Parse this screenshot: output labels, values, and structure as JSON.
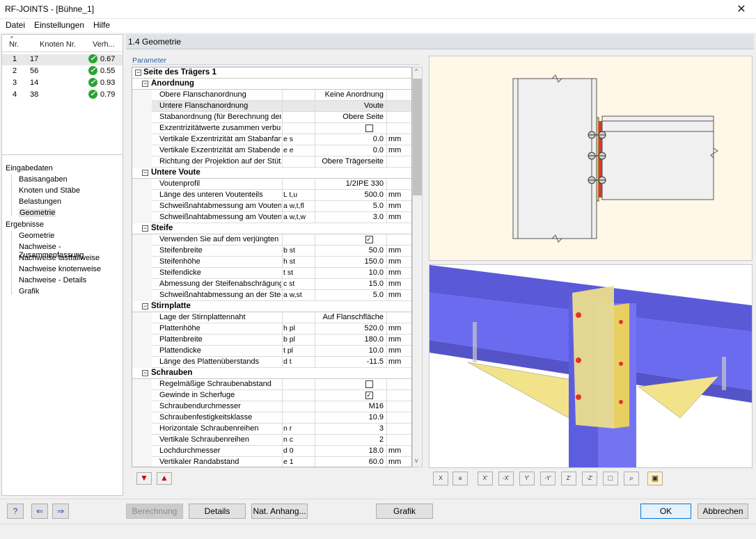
{
  "window": {
    "title": "RF-JOINTS - [Bühne_1]",
    "close_glyph": "✕"
  },
  "menu": [
    "Datei",
    "Einstellungen",
    "Hilfe"
  ],
  "nodes": {
    "headers": [
      "Nr.",
      "Knoten Nr.",
      "Verh..."
    ],
    "rows": [
      {
        "nr": "1",
        "knoten": "17",
        "verh": "0.67"
      },
      {
        "nr": "2",
        "knoten": "56",
        "verh": "0.55"
      },
      {
        "nr": "3",
        "knoten": "14",
        "verh": "0.93"
      },
      {
        "nr": "4",
        "knoten": "38",
        "verh": "0.79"
      }
    ]
  },
  "tree": {
    "eingabe": "Eingabedaten",
    "eingabe_items": [
      "Basisangaben",
      "Knoten und Stäbe",
      "Belastungen",
      "Geometrie"
    ],
    "ergebnisse": "Ergebnisse",
    "ergebnisse_items": [
      "Geometrie",
      "Nachweise - Zusammenfassung",
      "Nachweise lastfallweise",
      "Nachweise knotenweise",
      "Nachweise - Details",
      "Grafik"
    ]
  },
  "panel": {
    "title": "1.4 Geometrie",
    "param_label": "Parameter"
  },
  "grid": {
    "top_section": "Seite des Trägers 1",
    "rows": [
      {
        "type": "sec",
        "label": "Anordnung"
      },
      {
        "name": "Obere Flanschanordnung",
        "sym": "",
        "val": "Keine Anordnung",
        "unit": ""
      },
      {
        "name": "Untere Flanschanordnung",
        "sym": "",
        "val": "Voute",
        "unit": "",
        "sel": true
      },
      {
        "name": "Stabanordnung (für Berechnung der",
        "sym": "",
        "val": "Obere Seite",
        "unit": ""
      },
      {
        "name": "Exzentrizitätwerte zusammen verbun",
        "sym": "",
        "val": "",
        "unit": "",
        "cb": "unchecked"
      },
      {
        "name": "Vertikale Exzentrizität am Stabanfang",
        "sym": "e s",
        "val": "0.0",
        "unit": "mm"
      },
      {
        "name": "Vertikale Exzentrizität am Stabende",
        "sym": "e e",
        "val": "0.0",
        "unit": "mm"
      },
      {
        "name": "Richtung der Projektion auf der Stütz",
        "sym": "",
        "val": "Obere Trägerseite",
        "unit": ""
      },
      {
        "type": "sec",
        "label": "Untere Voute"
      },
      {
        "name": "Voutenprofil",
        "sym": "",
        "val": "1/2IPE 330",
        "unit": ""
      },
      {
        "name": "Länge des unteren Voutenteils",
        "sym": "L t,u",
        "val": "500.0",
        "unit": "mm"
      },
      {
        "name": "Schweißnahtabmessung am Voutenf",
        "sym": "a w,t,fl",
        "val": "5.0",
        "unit": "mm"
      },
      {
        "name": "Schweißnahtabmessung am Voutens",
        "sym": "a w,t,w",
        "val": "3.0",
        "unit": "mm"
      },
      {
        "type": "sec",
        "label": "Steife"
      },
      {
        "name": "Verwenden Sie auf dem verjüngten I",
        "sym": "",
        "val": "",
        "unit": "",
        "cb": "checked"
      },
      {
        "name": "Steifenbreite",
        "sym": "b st",
        "val": "50.0",
        "unit": "mm"
      },
      {
        "name": "Steifenhöhe",
        "sym": "h st",
        "val": "150.0",
        "unit": "mm"
      },
      {
        "name": "Steifendicke",
        "sym": "t st",
        "val": "10.0",
        "unit": "mm"
      },
      {
        "name": "Abmessung der Steifenabschrägung",
        "sym": "c st",
        "val": "15.0",
        "unit": "mm"
      },
      {
        "name": "Schweißnahtabmessung an der Steg",
        "sym": "a w,st",
        "val": "5.0",
        "unit": "mm"
      },
      {
        "type": "sec",
        "label": "Stirnplatte"
      },
      {
        "name": "Lage der Stirnplattennaht",
        "sym": "",
        "val": "Auf Flanschfläche",
        "unit": ""
      },
      {
        "name": "Plattenhöhe",
        "sym": "h pl",
        "val": "520.0",
        "unit": "mm"
      },
      {
        "name": "Plattenbreite",
        "sym": "b pl",
        "val": "180.0",
        "unit": "mm"
      },
      {
        "name": "Plattendicke",
        "sym": "t pl",
        "val": "10.0",
        "unit": "mm"
      },
      {
        "name": "Länge des Plattenüberstands",
        "sym": "d t",
        "val": "-11.5",
        "unit": "mm"
      },
      {
        "type": "sec",
        "label": "Schrauben"
      },
      {
        "name": "Regelmäßige Schraubenabstand",
        "sym": "",
        "val": "",
        "unit": "",
        "cb": "unchecked"
      },
      {
        "name": "Gewinde in Scherfuge",
        "sym": "",
        "val": "",
        "unit": "",
        "cb": "checked"
      },
      {
        "name": "Schraubendurchmesser",
        "sym": "",
        "val": "M16",
        "unit": ""
      },
      {
        "name": "Schraubenfestigkeitsklasse",
        "sym": "",
        "val": "10.9",
        "unit": ""
      },
      {
        "name": "Horizontale Schraubenreihen",
        "sym": "n r",
        "val": "3",
        "unit": ""
      },
      {
        "name": "Vertikale Schraubenreihen",
        "sym": "n c",
        "val": "2",
        "unit": ""
      },
      {
        "name": "Lochdurchmesser",
        "sym": "d 0",
        "val": "18.0",
        "unit": "mm"
      },
      {
        "name": "Vertikaler Randabstand",
        "sym": "e 1",
        "val": "60.0",
        "unit": "mm"
      }
    ]
  },
  "view_toolbar": [
    "X",
    "a",
    "X'",
    "-X'",
    "Y'",
    "-Y'",
    "Z'",
    "-Z'",
    "□",
    "⌕",
    "▣"
  ],
  "buttons": {
    "berechnung": "Berechnung",
    "details": "Details",
    "nat": "Nat. Anhang...",
    "grafik": "Grafik",
    "ok": "OK",
    "abbrechen": "Abbrechen"
  },
  "colors": {
    "ok_green": "#27a533",
    "beam_blue": "#6b6bf0",
    "plate_yellow": "#f2e38a",
    "weld_red": "#e0352b"
  }
}
